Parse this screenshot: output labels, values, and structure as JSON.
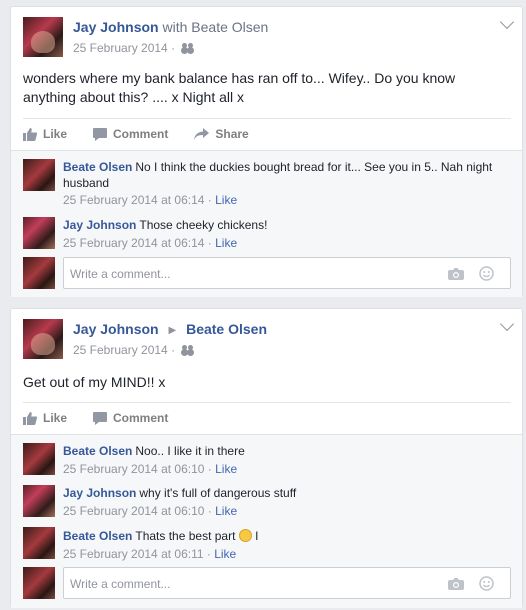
{
  "posts": [
    {
      "author": "Jay Johnson",
      "with_word": "with",
      "tagged": "Beate Olsen",
      "date": "25 February 2014 ·",
      "text": "wonders where my bank balance has ran off to... Wifey.. Do you know anything about this? .... x Night all x",
      "actions": {
        "like": "Like",
        "comment": "Comment",
        "share": "Share"
      },
      "comments": [
        {
          "author": "Beate Olsen",
          "text": "No I think the duckies bought bread for it... See you in 5.. Nah night husband",
          "time": "25 February 2014 at 06:14 ·",
          "like": "Like"
        },
        {
          "author": "Jay Johnson",
          "text": "Those cheeky chickens!",
          "time": "25 February 2014 at 06:14 ·",
          "like": "Like"
        }
      ],
      "write_placeholder": "Write a comment..."
    },
    {
      "author": "Jay Johnson",
      "target": "Beate Olsen",
      "date": "25 February 2014 ·",
      "text": "Get out of my MIND!! x",
      "actions": {
        "like": "Like",
        "comment": "Comment"
      },
      "comments": [
        {
          "author": "Beate Olsen",
          "text": "Noo.. I like it in there",
          "time": "25 February 2014 at 06:10 ·",
          "like": "Like"
        },
        {
          "author": "Jay Johnson",
          "text": "why it's full of dangerous stuff",
          "time": "25 February 2014 at 06:10 ·",
          "like": "Like"
        },
        {
          "author": "Beate Olsen",
          "text": "Thats the best part",
          "text_after_emoji": "I",
          "time": "25 February 2014 at 06:11 ·",
          "like": "Like"
        }
      ],
      "write_placeholder": "Write a comment..."
    }
  ],
  "colors": {
    "link": "#365899",
    "muted": "#90949c",
    "background": "#e9ebee"
  },
  "icons": [
    "friends-icon",
    "chevron-down-icon",
    "thumb-up-icon",
    "comment-icon",
    "share-icon",
    "camera-icon",
    "smiley-icon",
    "play-arrow-icon"
  ]
}
